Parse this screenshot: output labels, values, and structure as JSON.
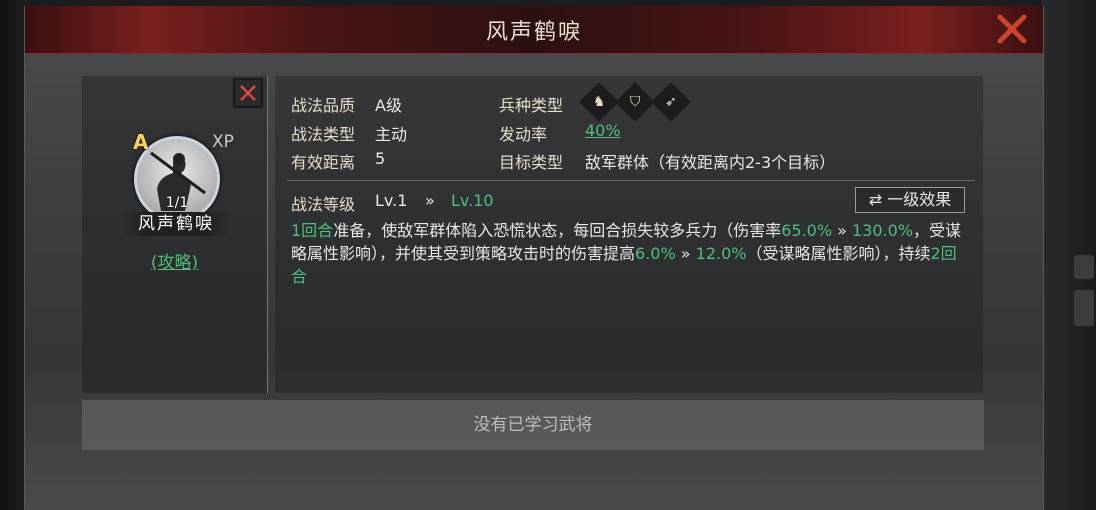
{
  "window": {
    "title": "风声鹤唳"
  },
  "skill_card": {
    "grade": "A",
    "xp_label": "XP",
    "count": "1/1",
    "name": "风声鹤唳",
    "guide_link": "(攻略)"
  },
  "info": {
    "quality_label": "战法品质",
    "quality_value": "A级",
    "type_label": "战法类型",
    "type_value": "主动",
    "range_label": "有效距离",
    "range_value": "5",
    "troop_label": "兵种类型",
    "troop_icons": [
      "cavalry-icon",
      "shield-icon",
      "archer-icon"
    ],
    "rate_label": "发动率",
    "rate_value": "40%",
    "target_label": "目标类型",
    "target_value": "敌军群体（有效距离内2-3个目标）"
  },
  "level": {
    "label": "战法等级",
    "from": "Lv.1",
    "arrow": "»",
    "to": "Lv.10",
    "effect_button": "一级效果"
  },
  "description": {
    "p1": "1回合",
    "p2": "准备，使敌军群体陷入恐慌状态，每回合损失较多兵力（伤害率",
    "p3": "65.0%",
    "p4": " » ",
    "p5": "130.0%",
    "p6": "，受谋略属性影响），并使其受到策略攻击时的伤害提高",
    "p7": "6.0%",
    "p8": " » ",
    "p9": "12.0%",
    "p10": "（受谋略属性影响），持续",
    "p11": "2回合"
  },
  "footer": {
    "text": "没有已学习武将"
  },
  "colors": {
    "accent_green": "#4ec07a",
    "title_red": "#7a1f1f",
    "grade_gold": "#f3d35a"
  }
}
